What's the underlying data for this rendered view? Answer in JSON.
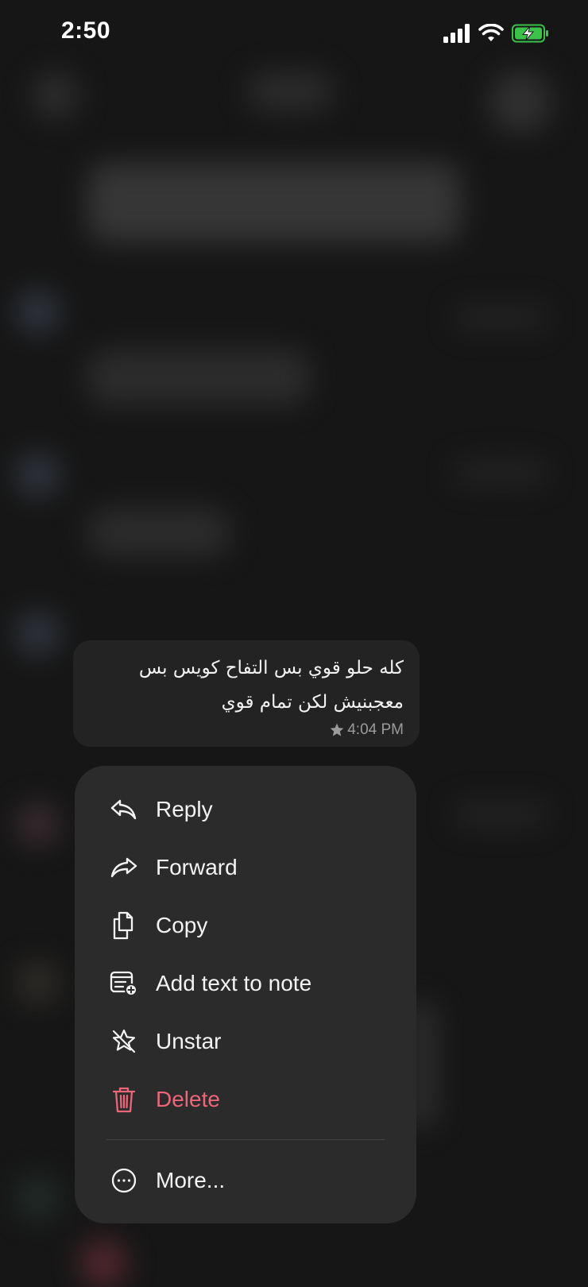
{
  "status_bar": {
    "time": "2:50",
    "icons": [
      "signal-icon",
      "wifi-icon",
      "battery-charging-icon"
    ],
    "battery_color": "#3cc24a"
  },
  "message": {
    "text": "كله حلو قوي بس التفاح كويس بس\nمعجبنيش لكن تمام قوي",
    "starred": true,
    "time": "4:04 PM"
  },
  "menu": {
    "items": [
      {
        "label": "Reply",
        "icon": "reply-icon"
      },
      {
        "label": "Forward",
        "icon": "forward-icon"
      },
      {
        "label": "Copy",
        "icon": "copy-icon"
      },
      {
        "label": "Add text to note",
        "icon": "add-note-icon"
      },
      {
        "label": "Unstar",
        "icon": "unstar-icon"
      },
      {
        "label": "Delete",
        "icon": "trash-icon",
        "color": "#eb6678"
      }
    ],
    "more": {
      "label": "More...",
      "icon": "more-icon"
    }
  }
}
